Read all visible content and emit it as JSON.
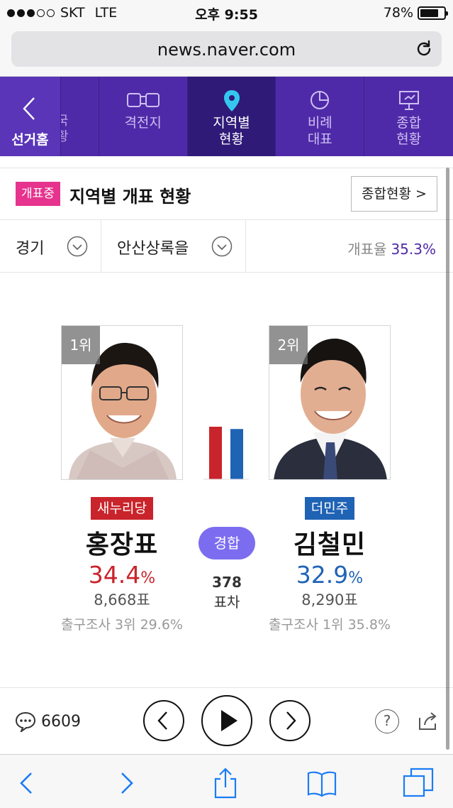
{
  "status": {
    "carrier": "SKT",
    "network": "LTE",
    "time": "오후 9:55",
    "battery": "78%"
  },
  "browser": {
    "url": "news.naver.com"
  },
  "nav": {
    "home_label": "선거홈",
    "peek_label": "국\n황",
    "tabs": [
      {
        "label": "격전지",
        "icon": "versus-icon"
      },
      {
        "label": "지역별\n현황",
        "icon": "location-pin-icon",
        "active": true
      },
      {
        "label": "비례\n대표",
        "icon": "pie-chart-icon"
      },
      {
        "label": "종합\n현황",
        "icon": "presentation-icon"
      }
    ]
  },
  "header": {
    "badge": "개표중",
    "title": "지역별 개표 현황",
    "button": "종합현황 >"
  },
  "filters": {
    "province": "경기",
    "district": "안산상록을",
    "rate_label": "개표율",
    "rate_value": "35.3%"
  },
  "candidates": [
    {
      "rank": "1위",
      "party": "새누리당",
      "party_color": "#c9242b",
      "name": "홍장표",
      "pct": "34.4",
      "pct_unit": "%",
      "votes": "8,668표",
      "exit": "출구조사 3위 29.6%",
      "color": "#c9242b"
    },
    {
      "rank": "2위",
      "party": "더민주",
      "party_color": "#1f63b5",
      "name": "김철민",
      "pct": "32.9",
      "pct_unit": "%",
      "votes": "8,290표",
      "exit": "출구조사 1위 35.8%",
      "color": "#1f63b5"
    }
  ],
  "contest": {
    "status": "경합",
    "diff": "378",
    "diff_label": "표차"
  },
  "player": {
    "comments": "6609"
  },
  "colors": {
    "accent": "#4f2aa8",
    "pink": "#e6338d",
    "contest": "#7c6df0"
  }
}
